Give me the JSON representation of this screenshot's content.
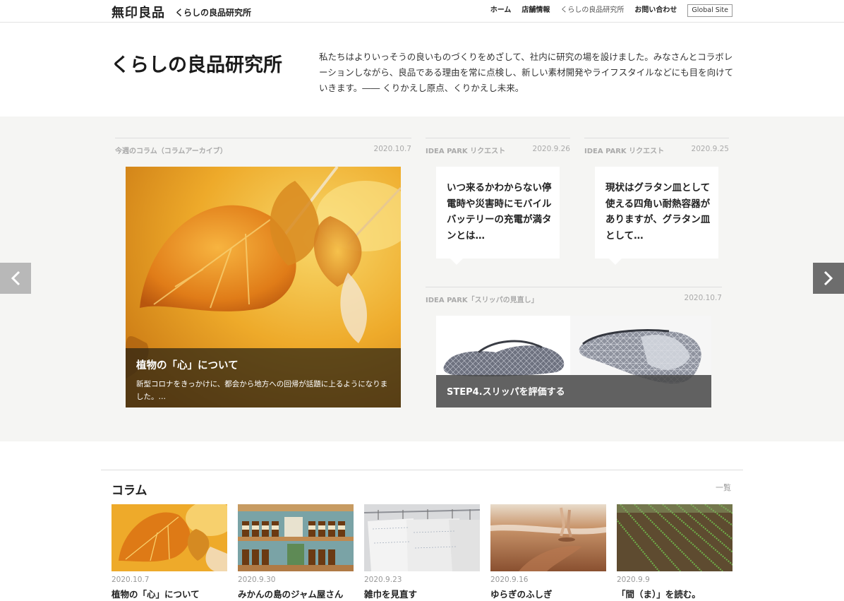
{
  "header": {
    "logo": "無印良品",
    "site_name": "くらしの良品研究所",
    "nav": [
      "ホーム",
      "店舗情報",
      "くらしの良品研究所",
      "お問い合わせ"
    ],
    "global_site": "Global Site"
  },
  "intro": {
    "title": "くらしの良品研究所",
    "text": "私たちはよりいっそうの良いものづくりをめざして、社内に研究の場を設けました。みなさんとコラボレーションしながら、良品である理由を常に点検し、新しい素材開発やライフスタイルなどにも目を向けていきます。―― くりかえし原点、くりかえし未来。"
  },
  "feature": {
    "column": {
      "label": "今週のコラム（コラムアーカイブ）",
      "date": "2020.10.7",
      "title": "植物の「心」について",
      "desc": "新型コロナをきっかけに、都会から地方への回帰が話題に上るようになりました。…"
    },
    "requests": [
      {
        "label": "IDEA PARK リクエスト",
        "date": "2020.9.26",
        "text": "いつ来るかわからない停電時や災害時にモバイルバッテリーの充電が満タンとは…"
      },
      {
        "label": "IDEA PARK リクエスト",
        "date": "2020.9.25",
        "text": "現状はグラタン皿として使える四角い耐熱容器がありますが、グラタン皿として…"
      }
    ],
    "slipper": {
      "label": "IDEA PARK「スリッパの見直し」",
      "date": "2020.10.7",
      "caption": "STEP4.スリッパを評価する"
    }
  },
  "columns": {
    "title": "コラム",
    "more": "一覧",
    "items": [
      {
        "date": "2020.10.7",
        "title": "植物の「心」について"
      },
      {
        "date": "2020.9.30",
        "title": "みかんの島のジャム屋さん"
      },
      {
        "date": "2020.9.23",
        "title": "雑巾を見直す"
      },
      {
        "date": "2020.9.16",
        "title": "ゆらぎのふしぎ"
      },
      {
        "date": "2020.9.9",
        "title": "「間（ま）」を読む。"
      }
    ]
  }
}
